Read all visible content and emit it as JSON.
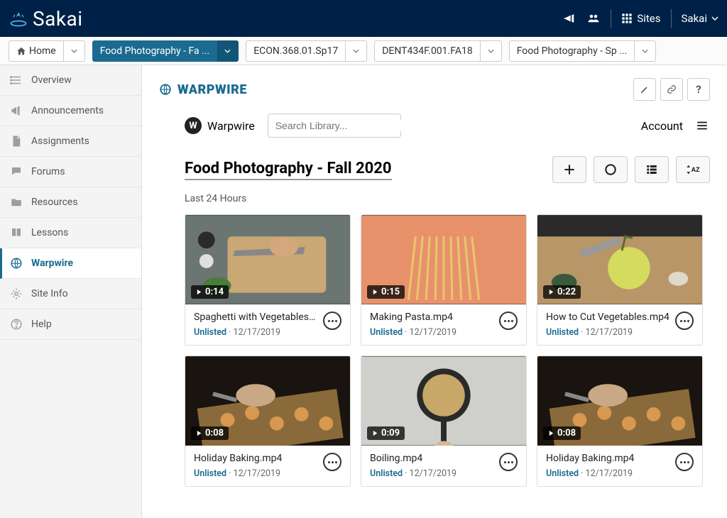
{
  "header": {
    "brand": "Sakai",
    "sites_label": "Sites",
    "user_menu": "Sakai"
  },
  "tabs": [
    {
      "label": "Home",
      "icon": "home",
      "active": false
    },
    {
      "label": "Food Photography - Fa ...",
      "active": true
    },
    {
      "label": "ECON.368.01.Sp17",
      "active": false
    },
    {
      "label": "DENT434F.001.FA18",
      "active": false
    },
    {
      "label": "Food Photography - Sp ...",
      "active": false
    }
  ],
  "sidebar": {
    "items": [
      {
        "label": "Overview",
        "icon": "list"
      },
      {
        "label": "Announcements",
        "icon": "announce"
      },
      {
        "label": "Assignments",
        "icon": "doc"
      },
      {
        "label": "Forums",
        "icon": "chat"
      },
      {
        "label": "Resources",
        "icon": "folder"
      },
      {
        "label": "Lessons",
        "icon": "book"
      },
      {
        "label": "Warpwire",
        "icon": "globe",
        "active": true
      },
      {
        "label": "Site Info",
        "icon": "gear"
      },
      {
        "label": "Help",
        "icon": "help"
      }
    ]
  },
  "main": {
    "title": "WARPWIRE"
  },
  "warpwire": {
    "logo": "Warpwire",
    "search_placeholder": "Search Library...",
    "account_label": "Account",
    "library_title": "Food Photography - Fall 2020",
    "section_label": "Last 24 Hours",
    "media": [
      {
        "title": "Spaghetti with Vegetables…",
        "duration": "0:14",
        "status": "Unlisted",
        "date": "12/17/2019",
        "bg": "cutboard"
      },
      {
        "title": "Making Pasta.mp4",
        "duration": "0:15",
        "status": "Unlisted",
        "date": "12/17/2019",
        "bg": "pasta"
      },
      {
        "title": "How to Cut Vegetables.mp4",
        "duration": "0:22",
        "status": "Unlisted",
        "date": "12/17/2019",
        "bg": "veg"
      },
      {
        "title": "Holiday Baking.mp4",
        "duration": "0:08",
        "status": "Unlisted",
        "date": "12/17/2019",
        "bg": "baking"
      },
      {
        "title": "Boiling.mp4",
        "duration": "0:09",
        "status": "Unlisted",
        "date": "12/17/2019",
        "bg": "boil"
      },
      {
        "title": "Holiday Baking.mp4",
        "duration": "0:08",
        "status": "Unlisted",
        "date": "12/17/2019",
        "bg": "baking"
      }
    ]
  }
}
